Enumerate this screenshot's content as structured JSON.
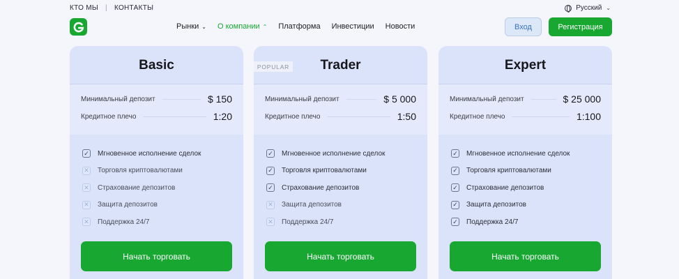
{
  "toplinks": {
    "about": "КТО МЫ",
    "separator": "|",
    "contacts": "КОНТАКТЫ"
  },
  "language": {
    "label": "Русский"
  },
  "nav": {
    "items": [
      {
        "label": "Рынки",
        "dropdown": "chevron-down",
        "active": false
      },
      {
        "label": "О компании",
        "dropdown": "chevron-up",
        "active": true
      },
      {
        "label": "Платформа",
        "active": false
      },
      {
        "label": "Инвестиции",
        "active": false
      },
      {
        "label": "Новости",
        "active": false
      }
    ]
  },
  "header": {
    "login_label": "Вход",
    "register_label": "Регистрация"
  },
  "colors": {
    "brand_green": "#18a832",
    "card_bg": "#dbe3fa",
    "login_blue": "#3b73c4"
  },
  "plans": [
    {
      "title": "Basic",
      "badge": "",
      "deposit_label": "Минимальный депозит",
      "deposit_value": "$ 150",
      "leverage_label": "Кредитное плечо",
      "leverage_value": "1:20",
      "features": [
        {
          "label": "Мгновенное исполнение сделок",
          "included": true
        },
        {
          "label": "Торговля криптовалютами",
          "included": false
        },
        {
          "label": "Страхование депозитов",
          "included": false
        },
        {
          "label": "Защита депозитов",
          "included": false
        },
        {
          "label": "Поддержка 24/7",
          "included": false
        }
      ],
      "cta": "Начать торговать"
    },
    {
      "title": "Trader",
      "badge": "POPULAR",
      "deposit_label": "Минимальный депозит",
      "deposit_value": "$ 5 000",
      "leverage_label": "Кредитное плечо",
      "leverage_value": "1:50",
      "features": [
        {
          "label": "Мгновенное исполнение сделок",
          "included": true
        },
        {
          "label": "Торговля криптовалютами",
          "included": true
        },
        {
          "label": "Страхование депозитов",
          "included": true
        },
        {
          "label": "Защита депозитов",
          "included": false
        },
        {
          "label": "Поддержка 24/7",
          "included": false
        }
      ],
      "cta": "Начать торговать"
    },
    {
      "title": "Expert",
      "badge": "",
      "deposit_label": "Минимальный депозит",
      "deposit_value": "$ 25 000",
      "leverage_label": "Кредитное плечо",
      "leverage_value": "1:100",
      "features": [
        {
          "label": "Мгновенное исполнение сделок",
          "included": true
        },
        {
          "label": "Торговля криптовалютами",
          "included": true
        },
        {
          "label": "Страхование депозитов",
          "included": true
        },
        {
          "label": "Защита депозитов",
          "included": true
        },
        {
          "label": "Поддержка 24/7",
          "included": true
        }
      ],
      "cta": "Начать торговать"
    }
  ]
}
